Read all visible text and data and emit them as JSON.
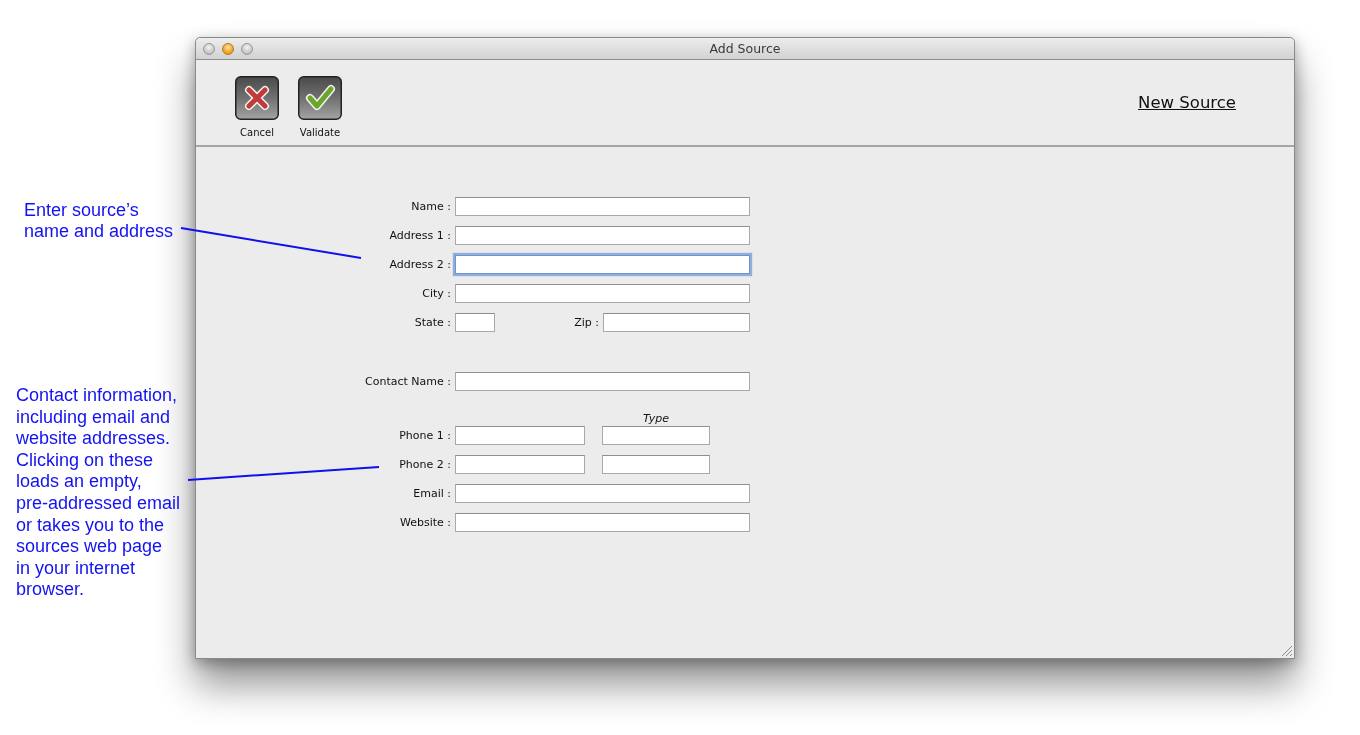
{
  "window": {
    "title": "Add Source"
  },
  "toolbar": {
    "buttons": [
      {
        "kind": "cancel",
        "label": "Cancel"
      },
      {
        "kind": "validate",
        "label": "Validate"
      }
    ],
    "heading": "New Source"
  },
  "form": {
    "sections": [
      {
        "rows": [
          {
            "kind": "text",
            "label": "Name :",
            "focused": false
          },
          {
            "kind": "text",
            "label": "Address 1 :",
            "focused": false
          },
          {
            "kind": "text",
            "label": "Address 2 :",
            "focused": true
          },
          {
            "kind": "text",
            "label": "City :",
            "focused": false
          },
          {
            "kind": "state_zip",
            "label": "State :",
            "second_label": "Zip :",
            "focused": false
          }
        ]
      },
      {
        "rows": [
          {
            "kind": "text",
            "label": "Contact Name :",
            "focused": false
          }
        ]
      },
      {
        "column_heading": "Type",
        "rows": [
          {
            "kind": "phone",
            "label": "Phone 1 :",
            "focused": false
          },
          {
            "kind": "phone",
            "label": "Phone 2 :",
            "focused": false
          },
          {
            "kind": "text",
            "label": "Email :",
            "focused": false
          },
          {
            "kind": "text",
            "label": "Website :",
            "focused": false
          }
        ]
      }
    ]
  },
  "annotations": [
    {
      "text": "Enter source’s\nname and address"
    },
    {
      "text": "Contact information,\nincluding email and\nwebsite addresses.\nClicking on these\nloads an empty,\npre-addressed email\nor takes you to the\nsources web page\nin your internet\nbrowser."
    }
  ]
}
